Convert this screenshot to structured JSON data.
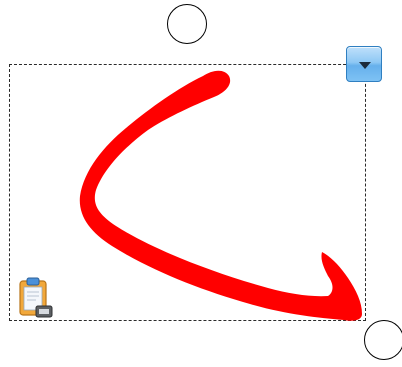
{
  "canvas": {
    "background": "#ffffff"
  },
  "selection": {
    "border_style": "dashed",
    "border_color": "#2a2a2a"
  },
  "stroke": {
    "color": "#ff0000",
    "shape": "curved-arrow"
  },
  "handles": {
    "rotate_icon": "rotate-handle-circle",
    "resize_icon": "resize-handle-circle"
  },
  "menu_button": {
    "icon": "chevron-down-icon",
    "accent": "#7ec2f4"
  },
  "paste_icon": {
    "icon": "clipboard-paste-icon",
    "accent": "#f2a83a"
  }
}
